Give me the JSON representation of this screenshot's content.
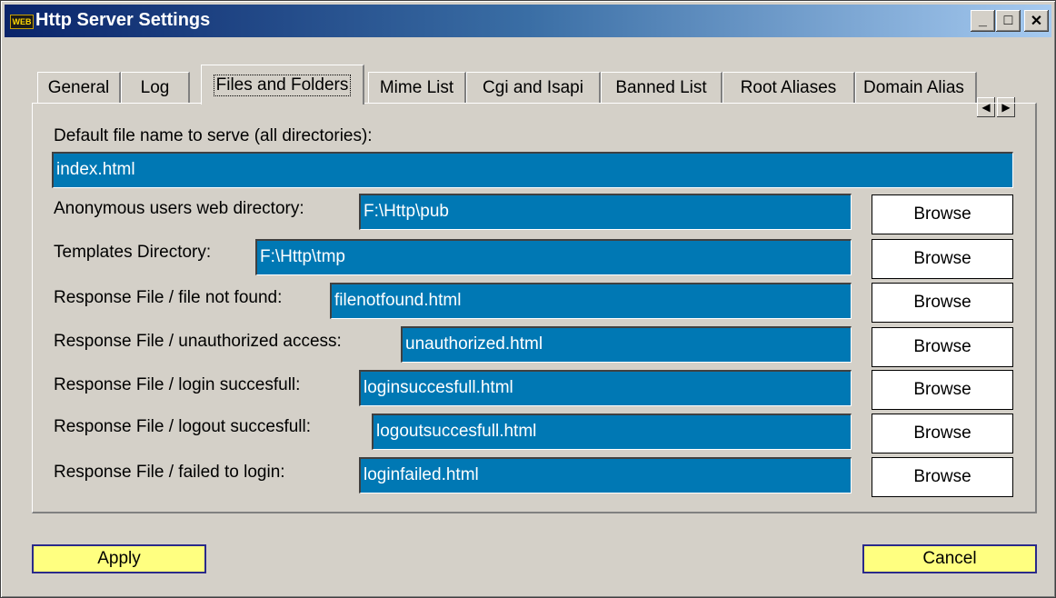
{
  "window": {
    "title": "Http Server Settings",
    "icon_text": "WEB",
    "controls": {
      "minimize": "_",
      "maximize": "□",
      "close": "✕"
    }
  },
  "tabs": [
    {
      "label": "General",
      "active": false
    },
    {
      "label": "Log",
      "active": false
    },
    {
      "label": "Files and Folders",
      "active": true
    },
    {
      "label": "Mime List",
      "active": false
    },
    {
      "label": "Cgi and Isapi",
      "active": false
    },
    {
      "label": "Banned List",
      "active": false
    },
    {
      "label": "Root Aliases",
      "active": false
    },
    {
      "label": "Domain Alias",
      "active": false
    }
  ],
  "tab_scroll": {
    "left": "◀",
    "right": "▶"
  },
  "files": {
    "default_file_label": "Default file name to serve (all directories):",
    "default_file_value": "index.html",
    "rows": [
      {
        "label": "Anonymous users web directory:",
        "value": "F:\\Http\\pub",
        "button": "Browse"
      },
      {
        "label": "Templates Directory:",
        "value": "F:\\Http\\tmp",
        "button": "Browse"
      },
      {
        "label": "Response File / file not found:",
        "value": "filenotfound.html",
        "button": "Browse"
      },
      {
        "label": "Response File / unauthorized access:",
        "value": "unauthorized.html",
        "button": "Browse"
      },
      {
        "label": "Response File / login succesfull:",
        "value": "loginsuccesfull.html",
        "button": "Browse"
      },
      {
        "label": "Response File / logout succesfull:",
        "value": "logoutsuccesfull.html",
        "button": "Browse"
      },
      {
        "label": "Response File / failed to login:",
        "value": "loginfailed.html",
        "button": "Browse"
      }
    ]
  },
  "footer": {
    "apply": "Apply",
    "cancel": "Cancel"
  },
  "colors": {
    "field_bg": "#0078b4",
    "button_yellow": "#ffff80",
    "title_start": "#0a246a",
    "title_end": "#a6caf0"
  }
}
